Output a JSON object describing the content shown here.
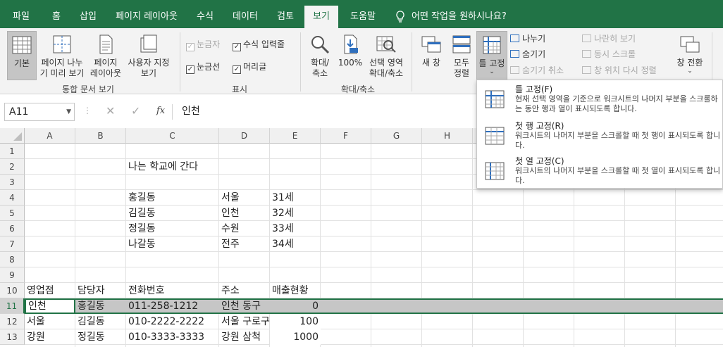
{
  "tabs": [
    "파일",
    "홈",
    "삽입",
    "페이지 레이아웃",
    "수식",
    "데이터",
    "검토",
    "보기",
    "도움말"
  ],
  "tell_me": "어떤 작업을 원하시나요?",
  "ribbon": {
    "workbook_views": {
      "normal": "기본",
      "page_break_1": "페이지 나누",
      "page_break_2": "기 미리 보기",
      "page_layout_1": "페이지",
      "page_layout_2": "레이아웃",
      "custom_1": "사용자 지정",
      "custom_2": "보기",
      "group_label": "통합 문서 보기"
    },
    "show": {
      "ruler": "눈금자",
      "formula_bar": "수식 입력줄",
      "gridlines": "눈금선",
      "headings": "머리글",
      "group_label": "표시"
    },
    "zoom": {
      "zoom_1": "확대/",
      "zoom_2": "축소",
      "hundred": "100%",
      "selection_1": "선택 영역",
      "selection_2": "확대/축소",
      "group_label": "확대/축소"
    },
    "window": {
      "new_window_1": "새 창",
      "arrange_1": "모두",
      "arrange_2": "정렬",
      "freeze": "틀 고정",
      "split": "나누기",
      "hide": "숨기기",
      "unhide": "숨기기 취소",
      "side_by_side": "나란히 보기",
      "sync_scroll": "동시 스크롤",
      "reset_position": "창 위치 다시 정렬",
      "switch": "창 전환"
    }
  },
  "formula_bar": {
    "name_box": "A11",
    "fx": "fx",
    "content": "인천"
  },
  "columns": [
    "A",
    "B",
    "C",
    "D",
    "E",
    "F",
    "G",
    "H"
  ],
  "rows": [
    "1",
    "2",
    "3",
    "4",
    "5",
    "6",
    "7",
    "8",
    "9",
    "10",
    "11",
    "12",
    "13"
  ],
  "cells": {
    "c2": "나는 학교에 간다",
    "c4": "홍길동",
    "d4": "서울",
    "e4": "31세",
    "c5": "김길동",
    "d5": "인천",
    "e5": "32세",
    "c6": "정길동",
    "d6": "수원",
    "e6": "33세",
    "c7": "나갈동",
    "d7": "전주",
    "e7": "34세",
    "a10": "영업점",
    "b10": "담당자",
    "c10": "전화번호",
    "d10": "주소",
    "e10": "매출현황",
    "a11": "인천",
    "b11": "홍길동",
    "c11": "011-258-1212",
    "d11": "인천 동구",
    "e11": "0",
    "a12": "서울",
    "b12": "김길동",
    "c12": "010-2222-2222",
    "d12": "서울 구로구",
    "e12": "100",
    "a13": "강원",
    "b13": "정길동",
    "c13": "010-3333-3333",
    "d13": "강원 삼척",
    "e13": "1000"
  },
  "freeze_menu": [
    {
      "title": "틀 고정(F)",
      "desc": "현재 선택 영역을 기준으로 워크시트의 나머지 부분을 스크롤하는 동안 행과 열이 표시되도록 합니다."
    },
    {
      "title": "첫 행 고정(R)",
      "desc": "워크시트의 나머지 부분을 스크롤할 때 첫 행이 표시되도록 합니다."
    },
    {
      "title": "첫 열 고정(C)",
      "desc": "워크시트의 나머지 부분을 스크롤할 때 첫 열이 표시되도록 합니다."
    }
  ],
  "colors": {
    "accent": "#217346",
    "selected_row": "#c6c6c6"
  }
}
